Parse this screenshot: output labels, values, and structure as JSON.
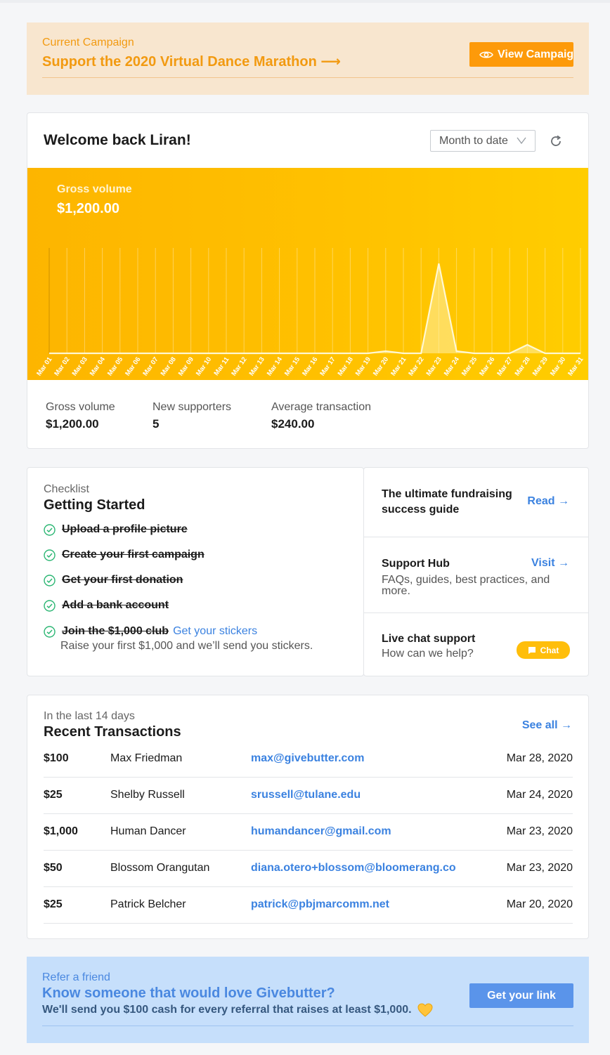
{
  "campaign": {
    "sub": "Current Campaign",
    "title": "Support the 2020 Virtual Dance Marathon ⟶",
    "button": "View Campaign"
  },
  "welcome": {
    "greeting": "Welcome back Liran!",
    "range": "Month to date",
    "chart_label": "Gross volume",
    "chart_value": "$1,200.00"
  },
  "stats": [
    {
      "label": "Gross volume",
      "value": "$1,200.00"
    },
    {
      "label": "New supporters",
      "value": "5"
    },
    {
      "label": "Average transaction",
      "value": "$240.00"
    }
  ],
  "chart_data": {
    "type": "area",
    "x": [
      "Mar 01",
      "Mar 02",
      "Mar 03",
      "Mar 04",
      "Mar 05",
      "Mar 06",
      "Mar 07",
      "Mar 08",
      "Mar 09",
      "Mar 10",
      "Mar 11",
      "Mar 12",
      "Mar 13",
      "Mar 14",
      "Mar 15",
      "Mar 16",
      "Mar 17",
      "Mar 18",
      "Mar 19",
      "Mar 20",
      "Mar 21",
      "Mar 22",
      "Mar 23",
      "Mar 24",
      "Mar 25",
      "Mar 26",
      "Mar 27",
      "Mar 28",
      "Mar 29",
      "Mar 30",
      "Mar 31"
    ],
    "values": [
      0,
      0,
      0,
      0,
      0,
      0,
      0,
      0,
      0,
      0,
      0,
      0,
      0,
      0,
      0,
      0,
      0,
      0,
      0,
      25,
      0,
      0,
      1050,
      25,
      0,
      0,
      0,
      100,
      0,
      0,
      0
    ],
    "title": "Gross volume",
    "ylim": [
      0,
      1200
    ],
    "grid": true
  },
  "checklist": {
    "sub": "Checklist",
    "title": "Getting Started",
    "items": [
      "Upload a profile picture",
      "Create your first campaign",
      "Get your first donation",
      "Add a bank account",
      "Join the $1,000 club"
    ],
    "sticker_link": "Get your stickers",
    "note": "Raise your first $1,000 and we’ll send you stickers."
  },
  "resources": {
    "guide_title_1": "The ultimate fundraising",
    "guide_title_2": "success guide",
    "guide_action": "Read →",
    "hub_title": "Support Hub",
    "hub_desc_1": "FAQs, guides, best practices, and",
    "hub_desc_2": "more.",
    "hub_action": "Visit →",
    "chat_title": "Live chat support",
    "chat_desc": "How can we help?",
    "chat_button": "Chat"
  },
  "transactions": {
    "sub": "In the last 14 days",
    "title": "Recent Transactions",
    "see_all": "See all →",
    "rows": [
      {
        "amount": "$100",
        "name": "Max Friedman",
        "email": "max@givebutter.com",
        "date": "Mar 28, 2020"
      },
      {
        "amount": "$25",
        "name": "Shelby Russell",
        "email": "srussell@tulane.edu",
        "date": "Mar 24, 2020"
      },
      {
        "amount": "$1,000",
        "name": "Human Dancer",
        "email": "humandancer@gmail.com",
        "date": "Mar 23, 2020"
      },
      {
        "amount": "$50",
        "name": "Blossom Orangutan",
        "email": "diana.otero+blossom@bloomerang.co",
        "date": "Mar 23, 2020"
      },
      {
        "amount": "$25",
        "name": "Patrick Belcher",
        "email": "patrick@pbjmarcomm.net",
        "date": "Mar 20, 2020"
      }
    ]
  },
  "refer": {
    "sub": "Refer a friend",
    "title": "Know someone that would love Givebutter?",
    "desc": "We'll send you $100 cash for every referral that raises at least $1,000.",
    "button": "Get your link"
  },
  "colors": {
    "accent_orange": "#fd9a0a",
    "chart_yellow": "#ffc100",
    "link_blue": "#3b82e0",
    "refer_blue": "#5a94ea"
  }
}
